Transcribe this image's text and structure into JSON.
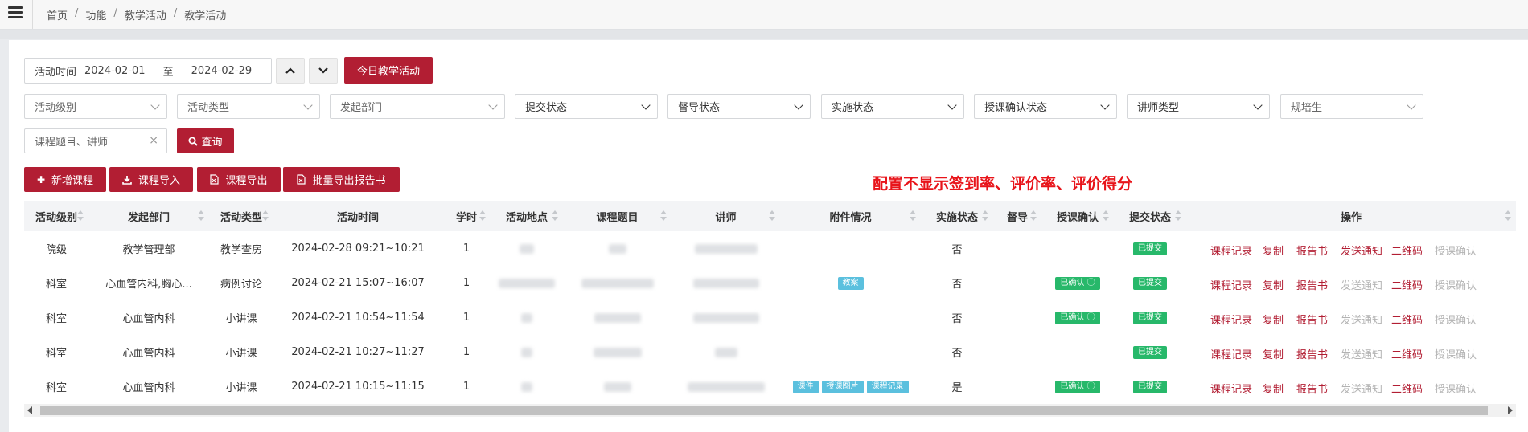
{
  "breadcrumb": [
    "首页",
    "功能",
    "教学活动",
    "教学活动"
  ],
  "breadcrumb_sep": "/",
  "filters": {
    "date_label": "活动时间",
    "date_from": "2024-02-01",
    "date_to_label": "至",
    "date_to": "2024-02-29",
    "today_button": "今日教学活动",
    "selects": [
      {
        "placeholder": "活动级别"
      },
      {
        "placeholder": "活动类型"
      },
      {
        "placeholder": "发起部门"
      },
      {
        "placeholder": "提交状态"
      },
      {
        "placeholder": "督导状态"
      },
      {
        "placeholder": "实施状态"
      },
      {
        "placeholder": "授课确认状态"
      },
      {
        "placeholder": "讲师类型"
      },
      {
        "placeholder": "规培生"
      }
    ],
    "keyword_placeholder": "课程题目、讲师",
    "clear_icon": "×",
    "search_button": "查询"
  },
  "toolbar": {
    "add": "新增课程",
    "import": "课程导入",
    "export": "课程导出",
    "batch_export": "批量导出报告书"
  },
  "annotation": "配置不显示签到率、评价率、评价得分",
  "table": {
    "headers": [
      "活动级别",
      "发起部门",
      "活动类型",
      "活动时间",
      "学时",
      "活动地点",
      "课程题目",
      "讲师",
      "附件情况",
      "实施状态",
      "督导",
      "授课确认",
      "提交状态",
      "操作"
    ],
    "ops": [
      "课程记录",
      "复制",
      "报告书",
      "发送通知",
      "二维码",
      "授课确认"
    ],
    "rows": [
      {
        "level": "院级",
        "dept": "教学管理部",
        "type": "教学查房",
        "time": "2024-02-28 09:21~10:21",
        "hours": "1",
        "attachments": [],
        "impl": "否",
        "confirm": "",
        "submit": "已提交",
        "notify_active": true
      },
      {
        "level": "科室",
        "dept": "心血管内科,胸心...",
        "type": "病例讨论",
        "time": "2024-02-21 15:07~16:07",
        "hours": "1",
        "attachments": [
          "教案"
        ],
        "impl": "否",
        "confirm": "已确认",
        "submit": "已提交",
        "notify_active": false
      },
      {
        "level": "科室",
        "dept": "心血管内科",
        "type": "小讲课",
        "time": "2024-02-21 10:54~11:54",
        "hours": "1",
        "attachments": [],
        "impl": "否",
        "confirm": "已确认",
        "submit": "已提交",
        "notify_active": false
      },
      {
        "level": "科室",
        "dept": "心血管内科",
        "type": "小讲课",
        "time": "2024-02-21 10:27~11:27",
        "hours": "1",
        "attachments": [],
        "impl": "否",
        "confirm": "",
        "submit": "已提交",
        "notify_active": false
      },
      {
        "level": "科室",
        "dept": "心血管内科",
        "type": "小讲课",
        "time": "2024-02-21 10:15~11:15",
        "hours": "1",
        "attachments": [
          "课件",
          "授课图片",
          "课程记录"
        ],
        "impl": "是",
        "confirm": "已确认",
        "submit": "已提交",
        "notify_active": false
      }
    ]
  },
  "colors": {
    "primary": "#b21e33",
    "success": "#27b86a",
    "info": "#5bc0de",
    "muted": "#b3b3b3",
    "annotation": "#e8141a"
  }
}
